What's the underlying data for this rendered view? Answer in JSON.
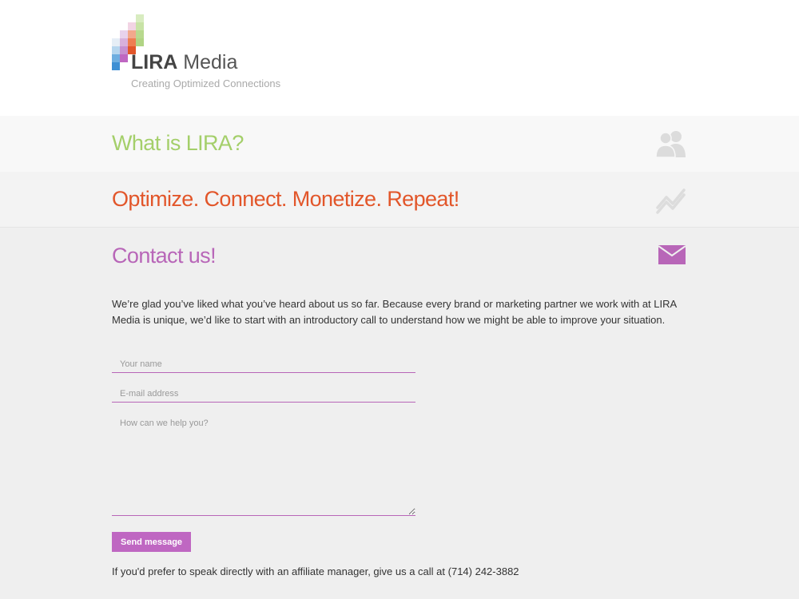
{
  "brand": {
    "name_bold": "LIRA",
    "name_light": " Media",
    "tagline": "Creating Optimized Connections"
  },
  "sections": {
    "what_is": {
      "title": "What is LIRA?",
      "color": "#a4cf6a",
      "icon": "users-icon"
    },
    "optimize": {
      "title": "Optimize. Connect. Monetize. Repeat!",
      "color": "#e2562a",
      "icon": "trend-icon"
    },
    "contact": {
      "title": "Contact us!",
      "color": "#b866b8",
      "icon": "mail-icon"
    }
  },
  "contact": {
    "intro": "We’re glad you’ve liked what you’ve heard about us so far. Because every brand or marketing partner we work with at LIRA Media is unique, we’d like to start with an introductory call to understand how we might be able to improve your situation.",
    "name_placeholder": "Your name",
    "email_placeholder": "E-mail address",
    "message_placeholder": "How can we help you?",
    "send_label": "Send message",
    "call_note": "If you'd prefer to speak directly with an affiliate manager, give us a call at (714) 242-3882"
  },
  "colors": {
    "accent_green": "#a4cf6a",
    "accent_orange": "#e2562a",
    "accent_purple": "#b866b8",
    "button": "#bf67c2",
    "icon_gray": "#dcdcdc"
  }
}
